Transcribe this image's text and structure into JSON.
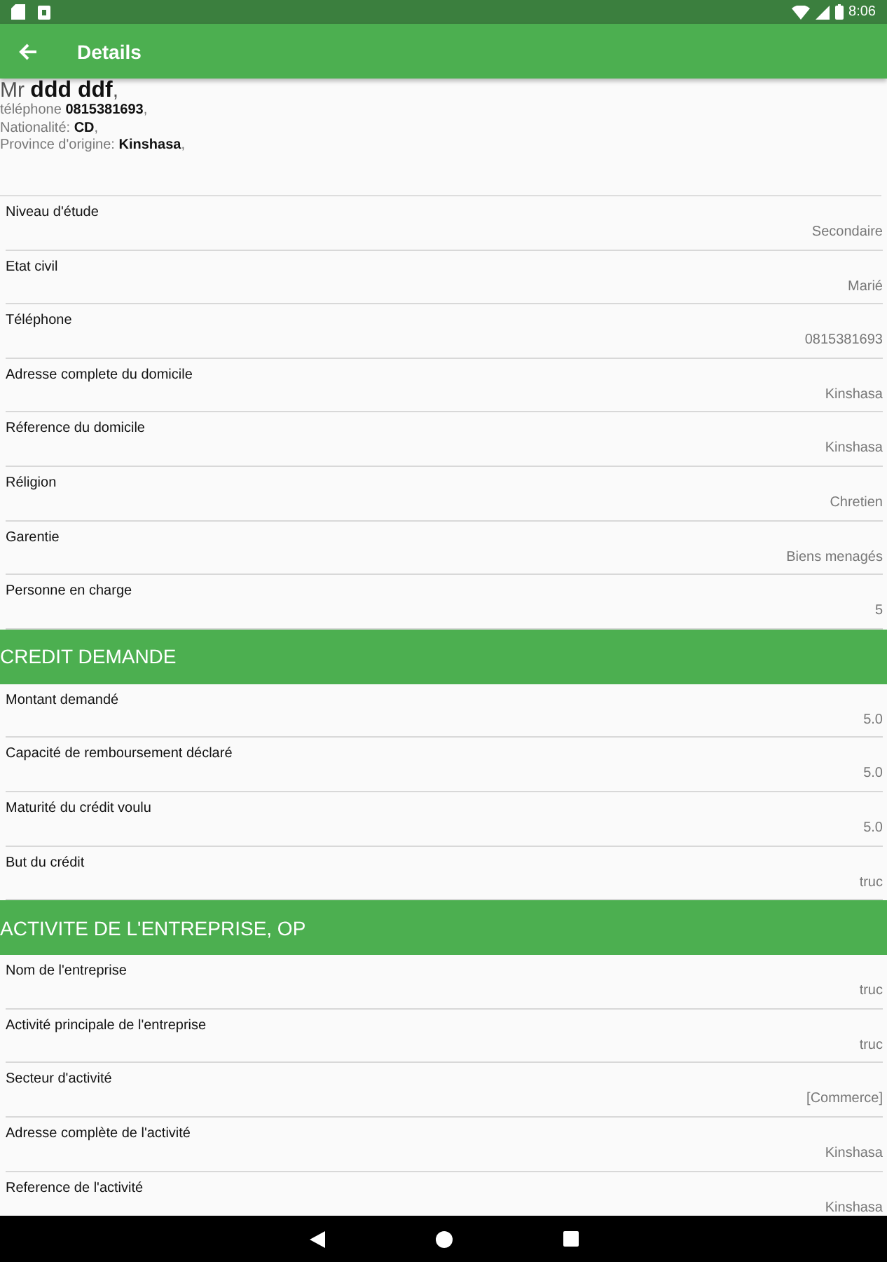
{
  "status_bar": {
    "time": "8:06"
  },
  "app_bar": {
    "title": "Details"
  },
  "header": {
    "name": "Mr **ddd  ddf**,",
    "lines": [
      "téléphone **0815381693**,",
      "Nationalité: **CD**,",
      "Province d'origine: **Kinshasa**,"
    ]
  },
  "sections": [
    {
      "rows": [
        {
          "label": "Niveau d'étude",
          "value": "Secondaire"
        },
        {
          "label": "Etat civil",
          "value": "Marié"
        },
        {
          "label": "Téléphone",
          "value": "0815381693"
        },
        {
          "label": "Adresse complete du domicile",
          "value": "Kinshasa"
        },
        {
          "label": "Réference du domicile",
          "value": "Kinshasa"
        },
        {
          "label": "Réligion",
          "value": "Chretien"
        },
        {
          "label": "Garentie",
          "value": "Biens menagés"
        },
        {
          "label": "Personne en charge",
          "value": "5"
        }
      ]
    },
    {
      "title": "CREDIT DEMANDE",
      "rows": [
        {
          "label": "Montant demandé",
          "value": "5.0"
        },
        {
          "label": "Capacité de remboursement déclaré",
          "value": "5.0"
        },
        {
          "label": "Maturité du crédit voulu",
          "value": "5.0"
        },
        {
          "label": "But du crédit",
          "value": "truc"
        }
      ]
    },
    {
      "title": "ACTIVITE DE L'ENTREPRISE, OP",
      "rows": [
        {
          "label": "Nom de l'entreprise",
          "value": "truc"
        },
        {
          "label": "Activité principale de l'entreprise",
          "value": "truc"
        },
        {
          "label": "Secteur d'activité",
          "value": "[Commerce]"
        },
        {
          "label": "Adresse complète de l'activité",
          "value": "Kinshasa"
        },
        {
          "label": "Reference de l'activité",
          "value": "Kinshasa"
        }
      ]
    }
  ]
}
